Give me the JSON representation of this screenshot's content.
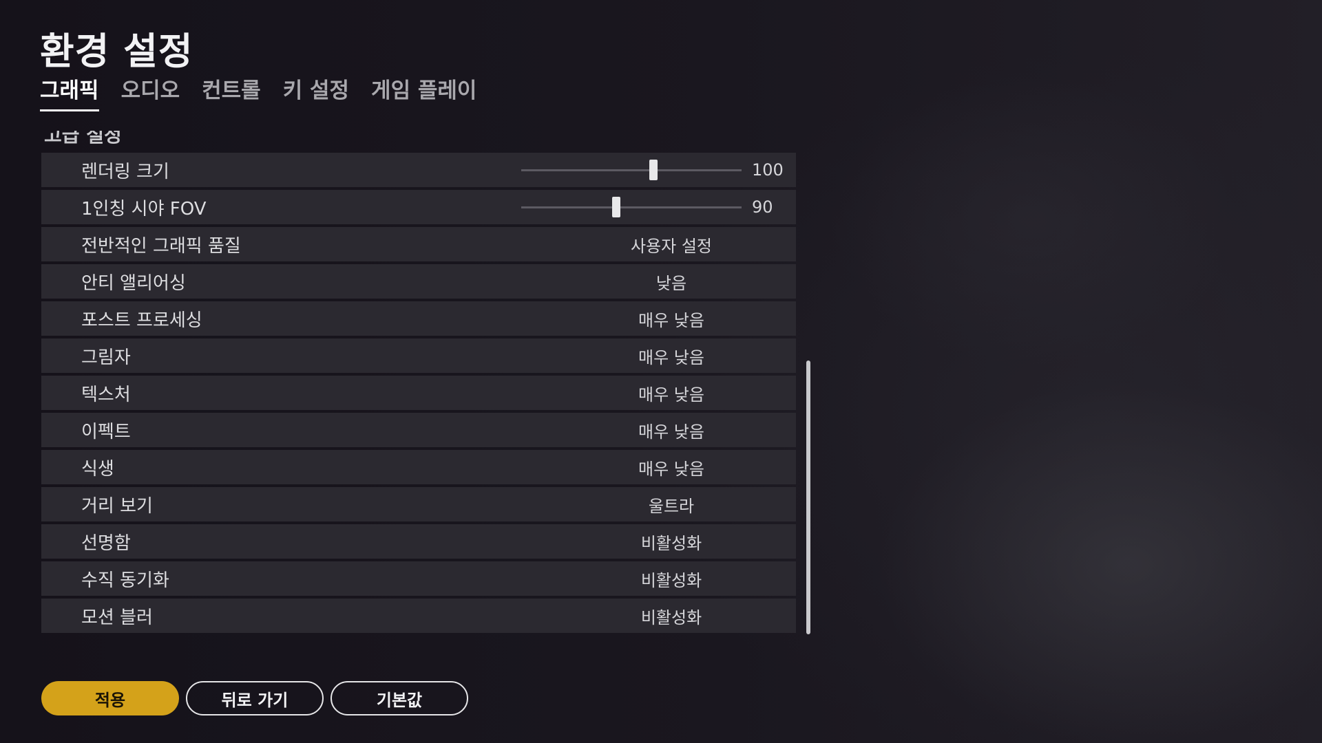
{
  "header": {
    "title": "환경 설정"
  },
  "tabs": [
    {
      "label": "그래픽",
      "active": true
    },
    {
      "label": "오디오",
      "active": false
    },
    {
      "label": "컨트롤",
      "active": false
    },
    {
      "label": "키 설정",
      "active": false
    },
    {
      "label": "게임 플레이",
      "active": false
    }
  ],
  "section": {
    "partial_heading": "고급 설정"
  },
  "sliders": [
    {
      "label": "렌더링 크기",
      "value": "100",
      "level": 0.6
    },
    {
      "label": "1인칭 시야 FOV",
      "value": "90",
      "level": 0.43
    }
  ],
  "settings": [
    {
      "label": "전반적인 그래픽 품질",
      "value": "사용자 설정"
    },
    {
      "label": "안티 앨리어싱",
      "value": "낮음"
    },
    {
      "label": "포스트 프로세싱",
      "value": "매우 낮음"
    },
    {
      "label": "그림자",
      "value": "매우 낮음"
    },
    {
      "label": "텍스처",
      "value": "매우 낮음"
    },
    {
      "label": "이펙트",
      "value": "매우 낮음"
    },
    {
      "label": "식생",
      "value": "매우 낮음"
    },
    {
      "label": "거리 보기",
      "value": "울트라"
    },
    {
      "label": "선명함",
      "value": "비활성화"
    },
    {
      "label": "수직 동기화",
      "value": "비활성화"
    },
    {
      "label": "모션 블러",
      "value": "비활성화"
    }
  ],
  "footer": {
    "apply_label": "적용",
    "back_label": "뒤로 가기",
    "default_label": "기본값"
  },
  "colors": {
    "accent": "#d4a21a",
    "row_bg": "#2b2930",
    "background": "#17141b"
  }
}
